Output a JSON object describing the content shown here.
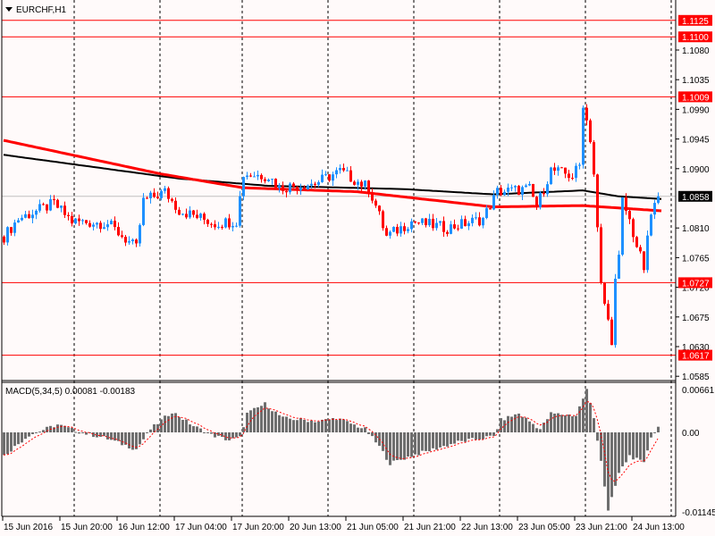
{
  "window": {
    "symbol_title": "EURCHF,H1"
  },
  "colors": {
    "background": "#fffafa",
    "bull": "#1e90ff",
    "bear": "#ff0000",
    "ma_fast": "#ff0000",
    "ma_slow": "#000000",
    "level_line": "#ff0000",
    "histogram": "#6e6e6e",
    "signal": "#ff0000",
    "current_price_line": "#c0c0c0"
  },
  "chart_data": [
    {
      "type": "candlestick",
      "title": "EURCHF,H1",
      "bar_count": 184,
      "close_keypoints": [
        [
          0,
          1.0797
        ],
        [
          4,
          1.0824
        ],
        [
          14,
          1.0847
        ],
        [
          19,
          1.082
        ],
        [
          29,
          1.0817
        ],
        [
          37,
          1.0779
        ],
        [
          39,
          1.0851
        ],
        [
          45,
          1.0865
        ],
        [
          49,
          1.0837
        ],
        [
          59,
          1.0817
        ],
        [
          65,
          1.0821
        ],
        [
          67,
          1.0892
        ],
        [
          74,
          1.0889
        ],
        [
          77,
          1.0871
        ],
        [
          87,
          1.0878
        ],
        [
          94,
          1.0896
        ],
        [
          102,
          1.0871
        ],
        [
          104,
          1.0844
        ],
        [
          107,
          1.0797
        ],
        [
          114,
          1.082
        ],
        [
          124,
          1.081
        ],
        [
          134,
          1.0824
        ],
        [
          138,
          1.0865
        ],
        [
          147,
          1.0869
        ],
        [
          149,
          1.0842
        ],
        [
          153,
          1.0898
        ],
        [
          159,
          1.0889
        ],
        [
          161,
          1.0905
        ],
        [
          162,
          1.1
        ],
        [
          164,
          1.0946
        ],
        [
          165,
          1.0892
        ],
        [
          167,
          1.0722
        ],
        [
          170,
          1.0641
        ],
        [
          171,
          1.0729
        ],
        [
          172,
          1.0763
        ],
        [
          173,
          1.0851
        ],
        [
          175,
          1.0821
        ],
        [
          177,
          1.0783
        ],
        [
          179,
          1.0749
        ],
        [
          181,
          1.0831
        ],
        [
          183,
          1.0858
        ]
      ],
      "ma_red_keypoints": [
        [
          0,
          1.0943
        ],
        [
          44,
          1.0892
        ],
        [
          67,
          1.0871
        ],
        [
          99,
          1.0865
        ],
        [
          137,
          1.0842
        ],
        [
          162,
          1.0844
        ],
        [
          184,
          1.0836
        ]
      ],
      "ma_black_keypoints": [
        [
          0,
          1.0921
        ],
        [
          49,
          1.0885
        ],
        [
          74,
          1.0874
        ],
        [
          112,
          1.0869
        ],
        [
          137,
          1.0861
        ],
        [
          162,
          1.0867
        ],
        [
          172,
          1.0858
        ],
        [
          184,
          1.0854
        ]
      ],
      "price_ticks": [
        "1.1080",
        "1.1035",
        "1.0990",
        "1.0945",
        "1.0900",
        "1.0810",
        "1.0765",
        "1.0720",
        "1.0675",
        "1.0630",
        "1.0585"
      ],
      "levels": [
        "1.1125",
        "1.1100",
        "1.1009",
        "1.0727",
        "1.0617"
      ],
      "current_price": "1.0858",
      "time_labels": [
        "15 Jun 2016",
        "15 Jun 20:00",
        "16 Jun 12:00",
        "17 Jun 04:00",
        "17 Jun 20:00",
        "20 Jun 13:00",
        "21 Jun 05:00",
        "21 Jun 21:00",
        "22 Jun 13:00",
        "23 Jun 05:00",
        "23 Jun 21:00",
        "24 Jun 13:00"
      ]
    },
    {
      "type": "bar",
      "title": "MACD(5,34,5) 0.00081 -0.00183",
      "histogram_keypoints": [
        [
          0,
          -0.0036
        ],
        [
          7,
          -0.0004
        ],
        [
          15,
          0.0012
        ],
        [
          22,
          -0.0001
        ],
        [
          28,
          -0.0008
        ],
        [
          37,
          -0.0026
        ],
        [
          41,
          0.0005
        ],
        [
          47,
          0.0032
        ],
        [
          53,
          0.001
        ],
        [
          58,
          -0.0004
        ],
        [
          63,
          -0.0012
        ],
        [
          66,
          -0.0008
        ],
        [
          68,
          0.0029
        ],
        [
          73,
          0.0044
        ],
        [
          78,
          0.0022
        ],
        [
          88,
          0.0017
        ],
        [
          93,
          0.0022
        ],
        [
          101,
          0.0005
        ],
        [
          105,
          -0.0022
        ],
        [
          108,
          -0.0048
        ],
        [
          114,
          -0.0036
        ],
        [
          127,
          -0.0015
        ],
        [
          137,
          -0.0006
        ],
        [
          139,
          0.0019
        ],
        [
          144,
          0.0029
        ],
        [
          150,
          0.0005
        ],
        [
          153,
          0.0029
        ],
        [
          160,
          0.0026
        ],
        [
          163,
          0.0066
        ],
        [
          165,
          0.0022
        ],
        [
          167,
          -0.0043
        ],
        [
          169,
          -0.0122
        ],
        [
          172,
          -0.0063
        ],
        [
          175,
          -0.0036
        ],
        [
          179,
          -0.0048
        ],
        [
          181,
          -0.0006
        ],
        [
          183,
          0.0008
        ]
      ],
      "axis_ticks": [
        "0.00661",
        "0.00",
        "-0.01145"
      ]
    }
  ]
}
